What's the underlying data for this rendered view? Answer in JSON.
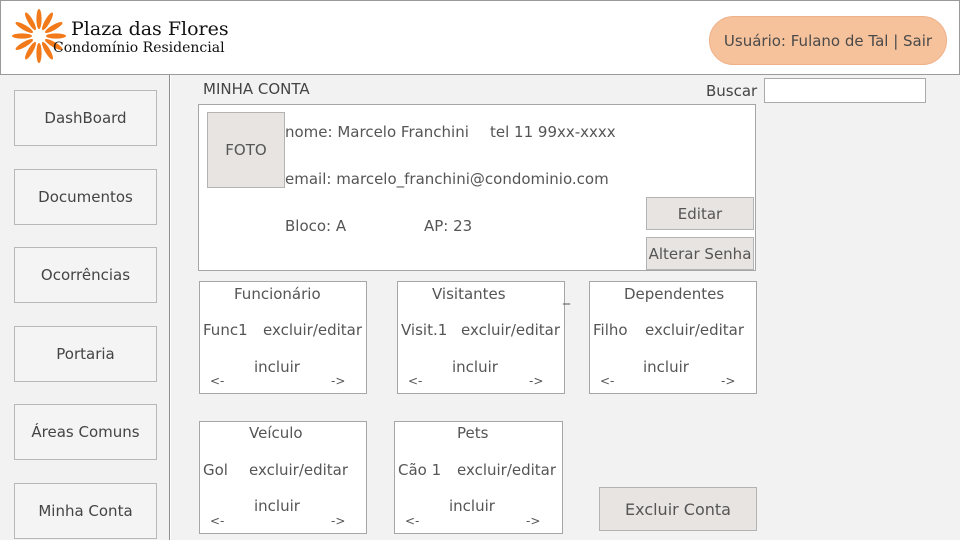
{
  "brand": {
    "title": "Plaza das Flores",
    "subtitle": "Condomínio Residencial",
    "logo_icon": "flower-logo-icon",
    "accent": "#f27a1a"
  },
  "user": {
    "label": "Usuário: Fulano de Tal | Sair",
    "pill_color": "#f6c29c"
  },
  "sidebar": {
    "items": [
      {
        "label": "DashBoard"
      },
      {
        "label": "Documentos"
      },
      {
        "label": "Ocorrências"
      },
      {
        "label": "Portaria"
      },
      {
        "label": "Áreas Comuns"
      },
      {
        "label": "Minha Conta"
      }
    ]
  },
  "page": {
    "title": "MINHA CONTA"
  },
  "search": {
    "label": "Buscar",
    "value": "",
    "placeholder": ""
  },
  "profile": {
    "photo_label": "FOTO",
    "name": "nome: Marcelo Franchini",
    "phone": "tel 11 99xx-xxxx",
    "email": "email: marcelo_franchini@condominio.com",
    "block": "Bloco: A",
    "apartment": "AP: 23",
    "edit_label": "Editar",
    "change_password_label": "Alterar Senha"
  },
  "cards": {
    "funcionario": {
      "title": "Funcionário",
      "item": "Func1",
      "action": "excluir/editar",
      "include": "incluir",
      "prev": "<-",
      "next": "->"
    },
    "visitantes": {
      "title": "Visitantes",
      "item": "Visit.1",
      "action": "excluir/editar",
      "include": "incluir",
      "prev": "<-",
      "next": "->"
    },
    "dependentes": {
      "title": "Dependentes",
      "item": "Filho",
      "action": "excluir/editar",
      "include": "incluir",
      "prev": "<-",
      "next": "->"
    },
    "veiculo": {
      "title": "Veículo",
      "item": "Gol",
      "action": "excluir/editar",
      "include": "incluir",
      "prev": "<-",
      "next": "->"
    },
    "pets": {
      "title": "Pets",
      "item": "Cão 1",
      "action": "excluir/editar",
      "include": "incluir",
      "prev": "<-",
      "next": "->"
    }
  },
  "stray_mark": "_",
  "delete_account_label": "Excluir Conta"
}
